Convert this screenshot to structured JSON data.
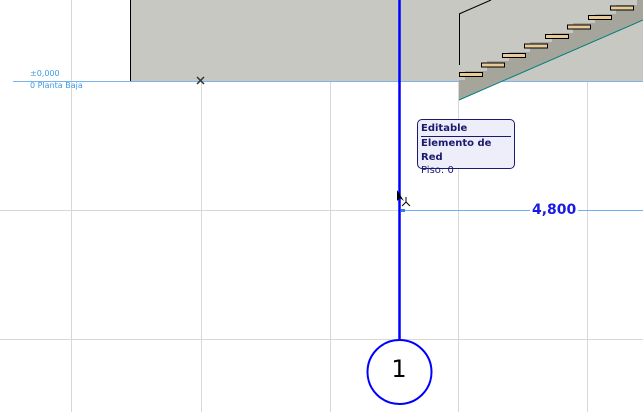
{
  "level": {
    "elevation": "±0,000",
    "name": "0 Planta Baja"
  },
  "tooltip": {
    "title": "Editable",
    "element": "Elemento de Red",
    "story": "Piso: 0"
  },
  "dimension": {
    "value": "4,800"
  },
  "grid_marker": {
    "label": "1"
  },
  "colors": {
    "grid_line": "#0000ff",
    "section_fill": "#c8c8c3",
    "stair_tread": "#e8cc98",
    "stair_edge": "#008080",
    "level_text": "#3a9be8"
  }
}
